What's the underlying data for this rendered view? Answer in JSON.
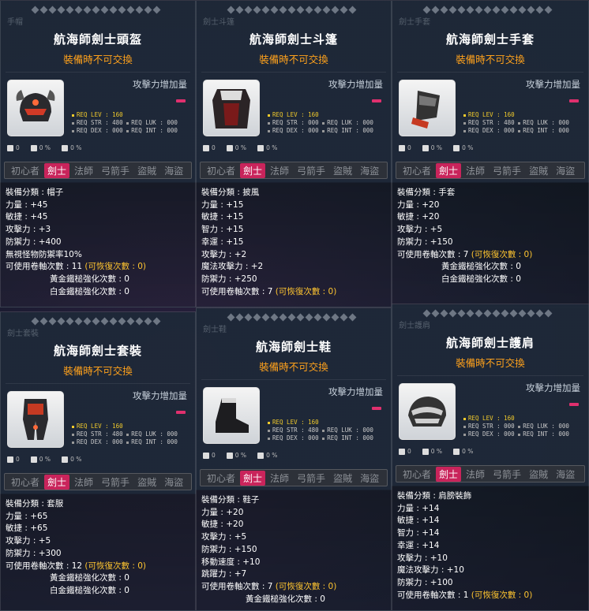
{
  "tooltips": [
    {
      "ghost": "手帽",
      "name": "航海師劍士頭盔",
      "untradeable": "裝備時不可交換",
      "attack_note": "攻擊力增加量",
      "req": {
        "lev_label": "REQ LEV :",
        "lev": "160",
        "str_label": "REQ STR :",
        "str": "480",
        "luk_label": "REQ LUK :",
        "luk": "000",
        "dex_label": "REQ DEX :",
        "dex": "000",
        "int_label": "REQ INT :",
        "int": "000"
      },
      "mini": [
        "0",
        "0 %",
        "0 %"
      ],
      "jobs": [
        "初心者",
        "劍士",
        "法師",
        "弓箭手",
        "盜賊",
        "海盜"
      ],
      "stats": [
        "裝備分類 : 帽子",
        "力量 : +45",
        "敏捷 : +45",
        "攻擊力 : +3",
        "防禦力 : +400",
        "無視怪物防禦率10%"
      ],
      "upgrade": "可使用卷軸次數 : 11",
      "recover": "(可恢復次數 : 0)",
      "gold": "黃金鐵槌強化次數 : 0",
      "plat": "白金鐵槌強化次數 : 0"
    },
    {
      "ghost": "劍士斗篷",
      "name": "航海師劍士斗篷",
      "untradeable": "裝備時不可交換",
      "attack_note": "攻擊力增加量",
      "req": {
        "lev_label": "REQ LEV :",
        "lev": "160",
        "str_label": "REQ STR :",
        "str": "000",
        "luk_label": "REQ LUK :",
        "luk": "000",
        "dex_label": "REQ DEX :",
        "dex": "000",
        "int_label": "REQ INT :",
        "int": "000"
      },
      "mini": [
        "0",
        "0 %",
        "0 %"
      ],
      "jobs": [
        "初心者",
        "劍士",
        "法師",
        "弓箭手",
        "盜賊",
        "海盜"
      ],
      "stats": [
        "裝備分類 : 披風",
        "力量 : +15",
        "敏捷 : +15",
        "智力 : +15",
        "幸運 : +15",
        "攻擊力 : +2",
        "魔法攻擊力 : +2",
        "防禦力 : +250"
      ],
      "upgrade": "可使用卷軸次數 : 7",
      "recover": "(可恢復次數 : 0)",
      "gold": "",
      "plat": ""
    },
    {
      "ghost": "劍士手套",
      "name": "航海師劍士手套",
      "untradeable": "裝備時不可交換",
      "attack_note": "攻擊力增加量",
      "req": {
        "lev_label": "REQ LEV :",
        "lev": "160",
        "str_label": "REQ STR :",
        "str": "480",
        "luk_label": "REQ LUK :",
        "luk": "000",
        "dex_label": "REQ DEX :",
        "dex": "000",
        "int_label": "REQ INT :",
        "int": "000"
      },
      "mini": [
        "0",
        "0 %",
        "0 %"
      ],
      "jobs": [
        "初心者",
        "劍士",
        "法師",
        "弓箭手",
        "盜賊",
        "海盜"
      ],
      "stats": [
        "裝備分類 : 手套",
        "力量 : +20",
        "敏捷 : +20",
        "攻擊力 : +5",
        "防禦力 : +150"
      ],
      "upgrade": "可使用卷軸次數 : 7",
      "recover": "(可恢復次數 : 0)",
      "gold": "黃金鐵槌強化次數 : 0",
      "plat": "白金鐵槌強化次數 : 0"
    },
    {
      "ghost": "劍士套裝",
      "name": "航海師劍士套裝",
      "untradeable": "裝備時不可交換",
      "attack_note": "攻擊力增加量",
      "req": {
        "lev_label": "REQ LEV :",
        "lev": "160",
        "str_label": "REQ STR :",
        "str": "480",
        "luk_label": "REQ LUK :",
        "luk": "000",
        "dex_label": "REQ DEX :",
        "dex": "000",
        "int_label": "REQ INT :",
        "int": "000"
      },
      "mini": [
        "0",
        "0 %",
        "0 %"
      ],
      "jobs": [
        "初心者",
        "劍士",
        "法師",
        "弓箭手",
        "盜賊",
        "海盜"
      ],
      "stats": [
        "裝備分類 : 套服",
        "力量 : +65",
        "敏捷 : +65",
        "攻擊力 : +5",
        "防禦力 : +300"
      ],
      "upgrade": "可使用卷軸次數 : 12",
      "recover": "(可恢復次數 : 0)",
      "gold": "黃金鐵槌強化次數 : 0",
      "plat": "白金鐵槌強化次數 : 0"
    },
    {
      "ghost": "劍士鞋",
      "name": "航海師劍士鞋",
      "untradeable": "裝備時不可交換",
      "attack_note": "攻擊力增加量",
      "req": {
        "lev_label": "REQ LEV :",
        "lev": "160",
        "str_label": "REQ STR :",
        "str": "480",
        "luk_label": "REQ LUK :",
        "luk": "000",
        "dex_label": "REQ DEX :",
        "dex": "000",
        "int_label": "REQ INT :",
        "int": "000"
      },
      "mini": [
        "0",
        "0 %",
        "0 %"
      ],
      "jobs": [
        "初心者",
        "劍士",
        "法師",
        "弓箭手",
        "盜賊",
        "海盜"
      ],
      "stats": [
        "裝備分類 : 鞋子",
        "力量 : +20",
        "敏捷 : +20",
        "攻擊力 : +5",
        "防禦力 : +150",
        "移動速度 : +10",
        "跳躍力 : +7"
      ],
      "upgrade": "可使用卷軸次數 : 7",
      "recover": "(可恢復次數 : 0)",
      "gold": "黃金鐵槌強化次數 : 0",
      "plat": ""
    },
    {
      "ghost": "劍士護肩",
      "name": "航海師劍士護肩",
      "untradeable": "裝備時不可交換",
      "attack_note": "攻擊力增加量",
      "req": {
        "lev_label": "REQ LEV :",
        "lev": "160",
        "str_label": "REQ STR :",
        "str": "000",
        "luk_label": "REQ LUK :",
        "luk": "000",
        "dex_label": "REQ DEX :",
        "dex": "000",
        "int_label": "REQ INT :",
        "int": "000"
      },
      "mini": [
        "0",
        "0 %",
        "0 %"
      ],
      "jobs": [
        "初心者",
        "劍士",
        "法師",
        "弓箭手",
        "盜賊",
        "海盜"
      ],
      "stats": [
        "裝備分類 : 肩膀裝飾",
        "力量 : +14",
        "敏捷 : +14",
        "智力 : +14",
        "幸運 : +14",
        "攻擊力 : +10",
        "魔法攻擊力 : +10",
        "防禦力 : +100"
      ],
      "upgrade": "可使用卷軸次數 : 1",
      "recover": "(可恢復次數 : 0)",
      "gold": "",
      "plat": ""
    }
  ],
  "colors": {
    "accent": "#c9245b",
    "title": "#ffffff",
    "untradeable": "#ffa21c",
    "highlight": "#ffc530",
    "req_yellow": "#f2cb2c"
  }
}
